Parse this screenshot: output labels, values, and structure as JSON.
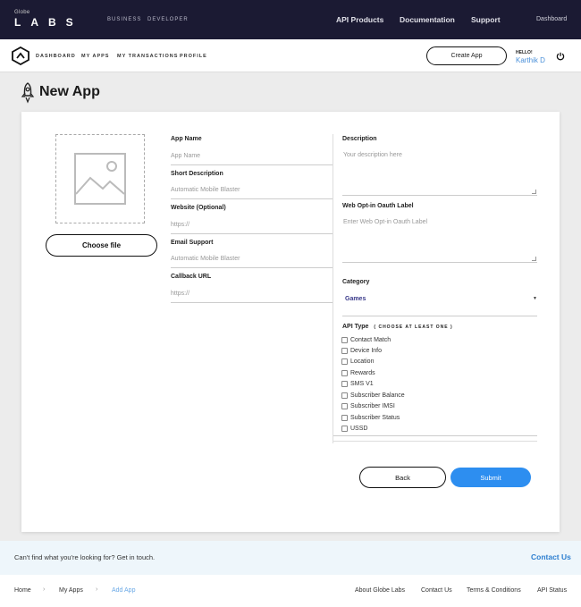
{
  "brand": {
    "small": "Globe",
    "big": "LABS"
  },
  "topnav": {
    "left": [
      "BUSINESS",
      "DEVELOPER"
    ],
    "right": [
      "API Products",
      "Documentation",
      "Support"
    ],
    "dashboard": "Dashboard"
  },
  "subnav": {
    "links": [
      "DASHBOARD",
      "MY APPS",
      "MY TRANSACTIONS",
      "PROFILE"
    ],
    "create_app": "Create App",
    "hello": "HELLO!",
    "username": "Karthik D"
  },
  "page": {
    "title": "New App"
  },
  "form": {
    "choose_file": "Choose file",
    "app_name": {
      "label": "App Name",
      "placeholder": "App Name"
    },
    "short_desc": {
      "label": "Short Description",
      "placeholder": "Automatic Mobile Blaster"
    },
    "website": {
      "label": "Website (Optional)",
      "placeholder": "https://"
    },
    "email": {
      "label": "Email Support",
      "placeholder": "Automatic Mobile Blaster"
    },
    "callback": {
      "label": "Callback URL",
      "placeholder": "https://"
    },
    "description": {
      "label": "Description",
      "placeholder": "Your description here"
    },
    "oauth": {
      "label": "Web Opt-in Oauth Label",
      "placeholder": "Enter Web Opt-in Oauth Label"
    },
    "category": {
      "label": "Category",
      "value": "Games"
    },
    "api_type": {
      "label": "API Type",
      "sub": "CHOOSE AT LEAST ONE",
      "options": [
        "Contact Match",
        "Device Info",
        "Location",
        "Rewards",
        "SMS V1",
        "Subscriber Balance",
        "Subscriber IMSI",
        "Subscriber Status",
        "USSD"
      ]
    },
    "back": "Back",
    "submit": "Submit"
  },
  "contact": {
    "text": "Can't find what you're looking for? Get in touch.",
    "link": "Contact Us"
  },
  "footer": {
    "crumbs": [
      "Home",
      "My Apps",
      "Add App"
    ],
    "links": [
      "About Globe Labs",
      "Contact Us",
      "Terms & Conditions",
      "API Status"
    ]
  },
  "colors": {
    "accent": "#2d8ef0",
    "topbar": "#1b1a33",
    "link": "#4a90d9"
  }
}
